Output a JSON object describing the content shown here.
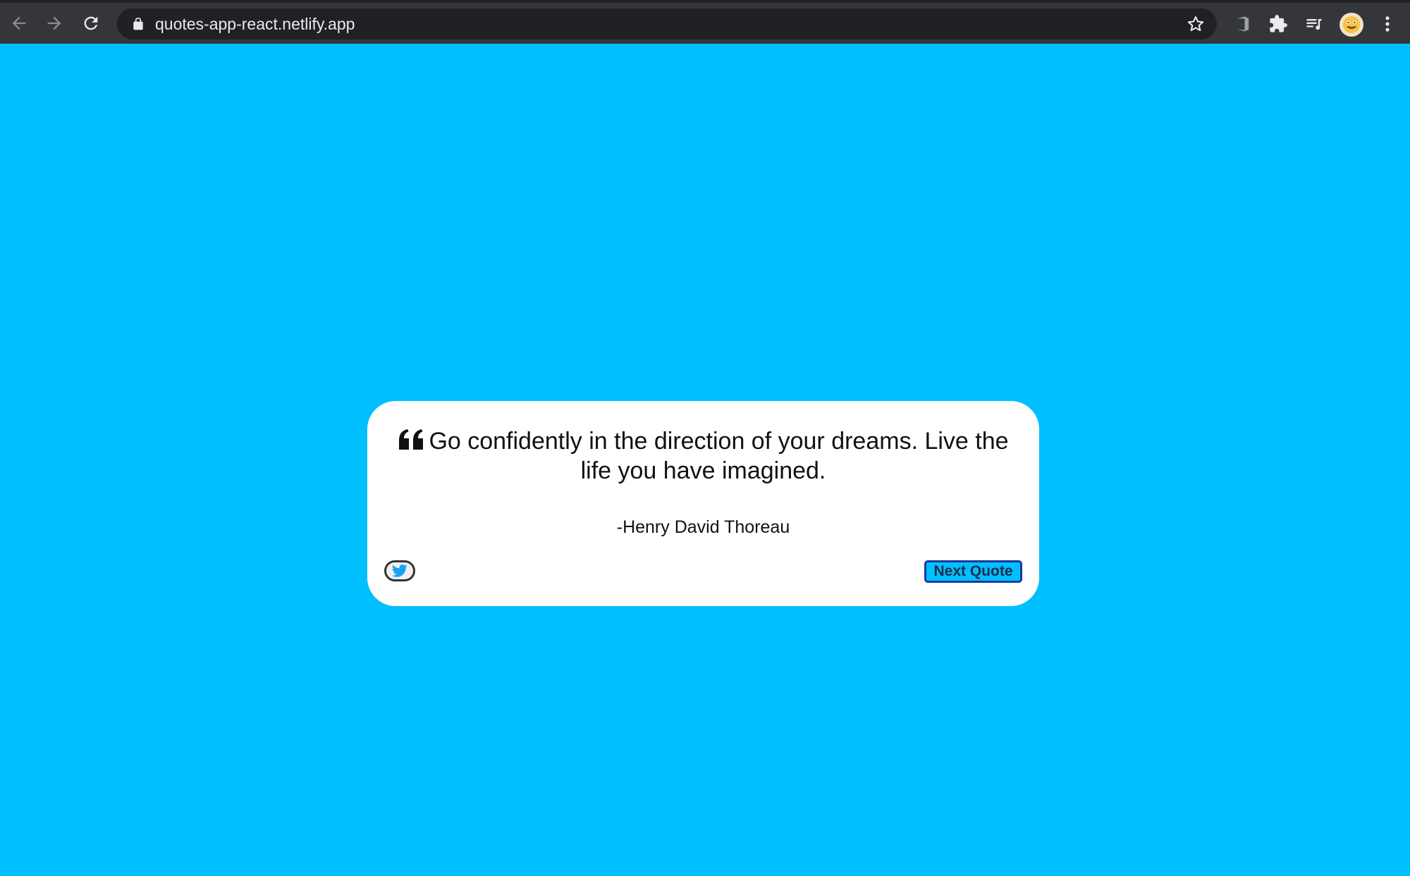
{
  "browser": {
    "url": "quotes-app-react.netlify.app",
    "icons": [
      "back-arrow-icon",
      "forward-arrow-icon",
      "reload-icon",
      "lock-icon",
      "star-icon",
      "office-icon",
      "puzzle-icon",
      "media-list-icon",
      "avatar",
      "kebab-menu-icon"
    ]
  },
  "quote": {
    "text": "Go confidently in the direction of your dreams. Live the life you have imagined.",
    "author": "-Henry David Thoreau"
  },
  "actions": {
    "next_label": "Next Quote"
  },
  "colors": {
    "background": "#00bfff",
    "card": "#ffffff",
    "chrome": "#35363a",
    "twitter": "#1da1f2"
  }
}
